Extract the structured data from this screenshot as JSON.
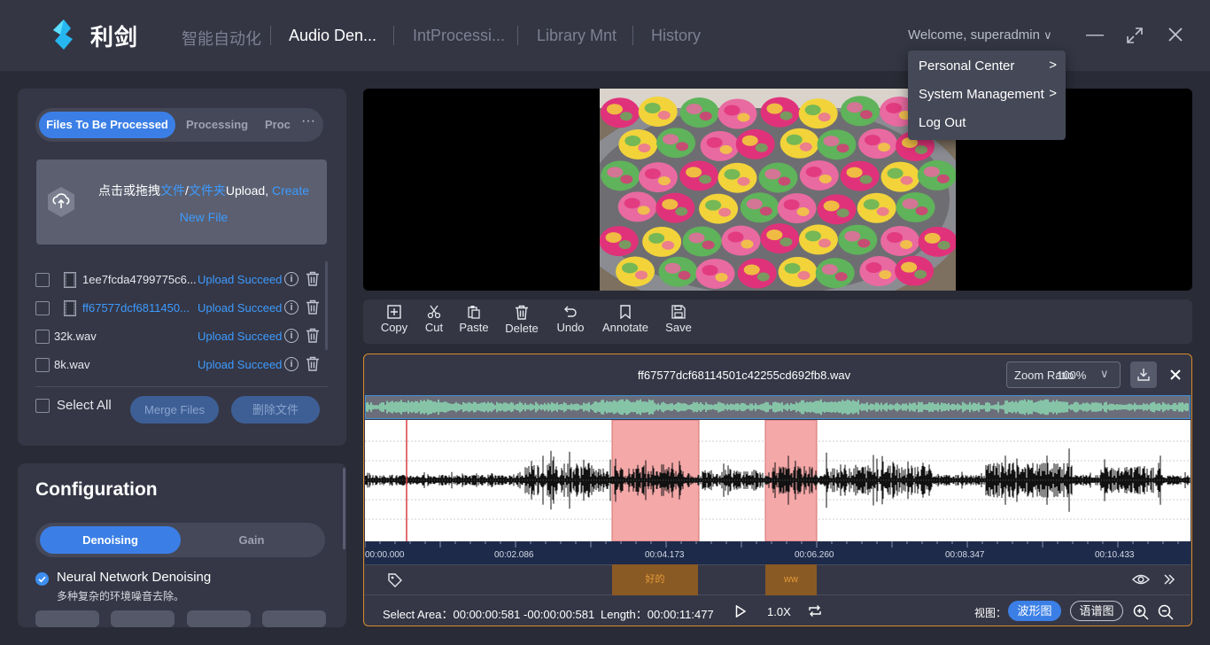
{
  "app": {
    "name": "利剑"
  },
  "nav": [
    "智能自动化",
    "Audio Den...",
    "IntProcessi...",
    "Library Mnt",
    "History"
  ],
  "user": {
    "welcome": "Welcome, superadmin"
  },
  "user_menu": [
    "Personal Center",
    "System Management",
    "Log Out"
  ],
  "file_tabs": {
    "active": "Files To Be Processed",
    "second": "Processing",
    "third": "Proc",
    "more": "···"
  },
  "upload": {
    "prefix": "点击或拖拽",
    "file": "文件",
    "slash": "/",
    "folder": "文件夹",
    "upload": "Upload, ",
    "create": "Create",
    "new_file": "New File"
  },
  "files": [
    {
      "name": "1ee7fcda4799775c6...",
      "status": "Upload Succeed",
      "type": "video"
    },
    {
      "name": "ff67577dcf6811450...",
      "status": "Upload Succeed",
      "type": "video",
      "active": true
    },
    {
      "name": "32k.wav",
      "status": "Upload Succeed",
      "type": "audio"
    },
    {
      "name": "8k.wav",
      "status": "Upload Succeed",
      "type": "audio"
    }
  ],
  "select_all": "Select All",
  "merge_files": "Merge Files",
  "delete_files": "删除文件",
  "config": {
    "title": "Configuration",
    "tabs": [
      "Denoising",
      "Gain"
    ],
    "option": "Neural Network Denoising",
    "desc": "多种复杂的环境噪音去除。"
  },
  "toolbar": [
    "Copy",
    "Cut",
    "Paste",
    "Delete",
    "Undo",
    "Annotate",
    "Save"
  ],
  "audio": {
    "filename": "ff67577dcf68114501c42255cd692fb8.wav",
    "zoom_label": "Zoom Ratio",
    "zoom_value": "100%",
    "ticks": [
      "00:00.000",
      "00:02.086",
      "00:04.173",
      "00:06.260",
      "00:08.347",
      "00:10.433"
    ],
    "annotations": [
      "好的",
      "ww"
    ],
    "select_area_label": "Select Area：",
    "select_area_value": "00:00:00:581 -00:00:00:581",
    "length_label": "Length：",
    "length_value": "00:00:11:477",
    "speed": "1.0X",
    "view_label": "视图：",
    "view_waveform": "波形图",
    "view_spectrogram": "语谱图"
  },
  "colors": {
    "accent": "#3b7fe6",
    "link": "#3d9bff",
    "region": "#f08a8a",
    "annotation": "#8a5a24"
  }
}
